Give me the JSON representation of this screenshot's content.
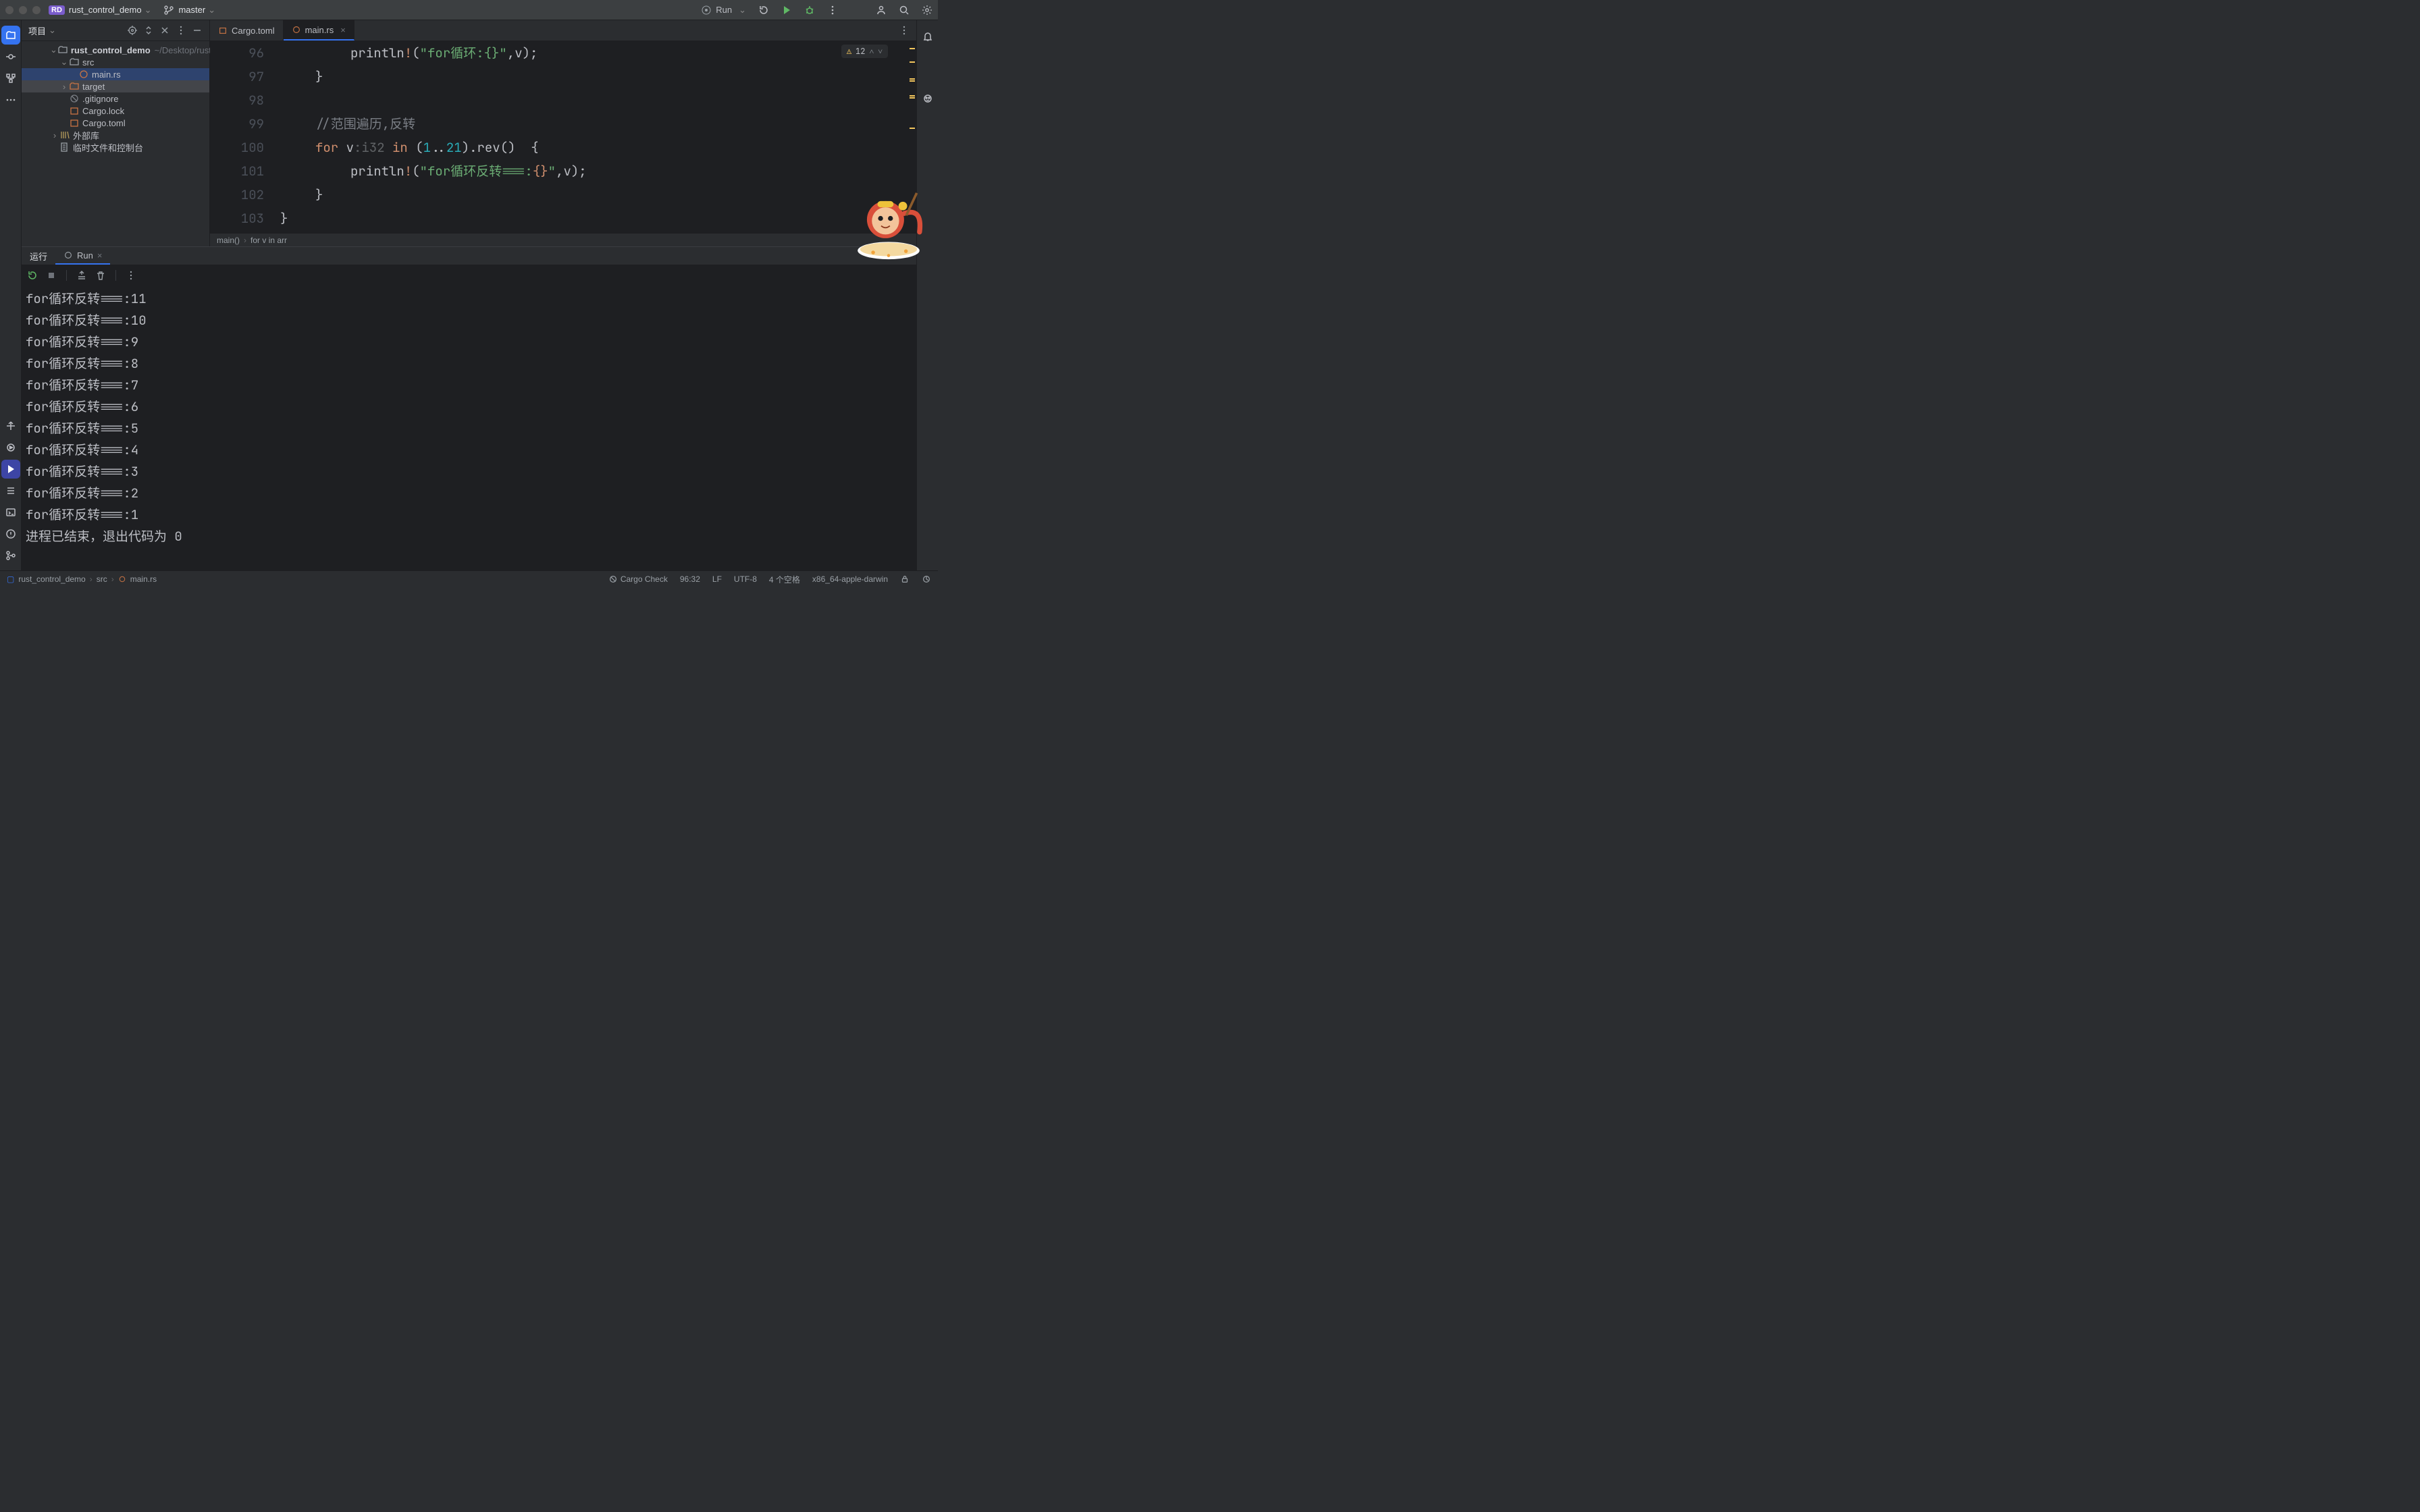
{
  "title": {
    "project_chip": "RD",
    "project": "rust_control_demo",
    "branch": "master",
    "run_label": "Run"
  },
  "sidebar": {
    "title": "项目",
    "root": {
      "name": "rust_control_demo",
      "path": "~/Desktop/rust_control_demo"
    },
    "src": "src",
    "main_rs": "main.rs",
    "target": "target",
    "gitignore": ".gitignore",
    "cargo_lock": "Cargo.lock",
    "cargo_toml": "Cargo.toml",
    "ext_libs": "外部库",
    "scratch": "临时文件和控制台"
  },
  "tabs": {
    "cargo": "Cargo.toml",
    "main": "main.rs"
  },
  "inspections": {
    "warn_count": "12"
  },
  "code": {
    "lines": [
      {
        "num": "96",
        "html": "        println!(\"for循环:{}\",v);"
      },
      {
        "num": "97",
        "html": "    }"
      },
      {
        "num": "98",
        "html": ""
      },
      {
        "num": "99",
        "html": "    //范围遍历,反转"
      },
      {
        "num": "100",
        "html": "    for v:i32 in (1..21).rev()  {"
      },
      {
        "num": "101",
        "html": "        println!(\"for循环反转===:{}\",v);"
      },
      {
        "num": "102",
        "html": "    }"
      },
      {
        "num": "103",
        "html": "}"
      }
    ]
  },
  "breadcrumb": {
    "a": "main()",
    "b": "for v in arr"
  },
  "run": {
    "tab": "运行",
    "conf": "Run"
  },
  "console_lines": [
    "for循环反转===:11",
    "for循环反转===:10",
    "for循环反转===:9",
    "for循环反转===:8",
    "for循环反转===:7",
    "for循环反转===:6",
    "for循环反转===:5",
    "for循环反转===:4",
    "for循环反转===:3",
    "for循环反转===:2",
    "for循环反转===:1",
    "",
    "进程已结束，退出代码为 0"
  ],
  "status": {
    "crumb1": "rust_control_demo",
    "crumb2": "src",
    "crumb3": "main.rs",
    "cargo": "Cargo Check",
    "pos": "96:32",
    "eol": "LF",
    "enc": "UTF-8",
    "indent": "4 个空格",
    "target": "x86_64-apple-darwin"
  }
}
